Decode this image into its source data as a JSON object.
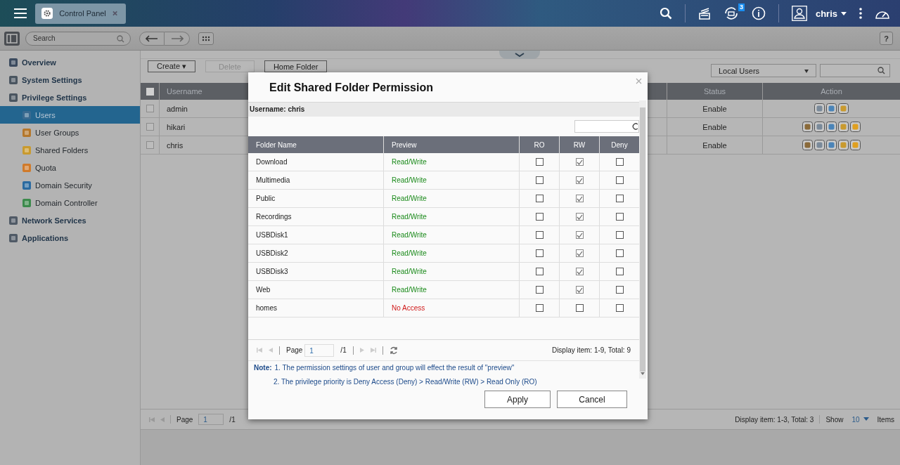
{
  "top_bar": {
    "app_tab": {
      "title": "Control Panel"
    },
    "notification_count": "3",
    "user": "chris"
  },
  "toolbar": {
    "search": {
      "placeholder": "Search"
    },
    "help": "?"
  },
  "sidebar": {
    "items": [
      {
        "label": "Overview",
        "selected": false
      },
      {
        "label": "System Settings",
        "selected": false
      },
      {
        "label": "Privilege Settings",
        "selected": false,
        "children": [
          {
            "label": "Users",
            "selected": true
          },
          {
            "label": "User Groups",
            "selected": false
          },
          {
            "label": "Shared Folders",
            "selected": false
          },
          {
            "label": "Quota",
            "selected": false
          },
          {
            "label": "Domain Security",
            "selected": false
          },
          {
            "label": "Domain Controller",
            "selected": false
          }
        ]
      },
      {
        "label": "Network Services",
        "selected": false
      },
      {
        "label": "Applications",
        "selected": false
      }
    ]
  },
  "users_panel": {
    "buttons": [
      {
        "label": "Create ▾",
        "disabled": false
      },
      {
        "label": "Delete",
        "disabled": true
      },
      {
        "label": "Home Folder",
        "disabled": false
      }
    ],
    "filter": "Local Users",
    "table": {
      "all_checked": false,
      "columns": [
        "Username",
        "Status",
        "Action"
      ],
      "rows": [
        {
          "username": "admin",
          "status": "Enable",
          "checked": false,
          "kind": "admin"
        },
        {
          "username": "hikari",
          "status": "Enable",
          "checked": false,
          "kind": "user"
        },
        {
          "username": "chris",
          "status": "Enable",
          "checked": false,
          "kind": "user"
        }
      ]
    },
    "pager": {
      "page_label": "Page",
      "page": "1",
      "of": "/1",
      "display": "Display item: 1-3, Total: 3",
      "show_label": "Show",
      "show_value": "10",
      "items_label": "Items"
    }
  },
  "dialog": {
    "title": "Edit Shared Folder Permission",
    "username": "Username: chris",
    "columns": [
      "Folder Name",
      "Preview",
      "RO",
      "RW",
      "Deny"
    ],
    "rows": [
      {
        "folder": "Download",
        "preview": "Read/Write",
        "kind": "rw",
        "ro": false,
        "rw": true,
        "deny": false
      },
      {
        "folder": "Multimedia",
        "preview": "Read/Write",
        "kind": "rw",
        "ro": false,
        "rw": true,
        "deny": false
      },
      {
        "folder": "Public",
        "preview": "Read/Write",
        "kind": "rw",
        "ro": false,
        "rw": true,
        "deny": false
      },
      {
        "folder": "Recordings",
        "preview": "Read/Write",
        "kind": "rw",
        "ro": false,
        "rw": true,
        "deny": false
      },
      {
        "folder": "USBDisk1",
        "preview": "Read/Write",
        "kind": "rw",
        "ro": false,
        "rw": true,
        "deny": false
      },
      {
        "folder": "USBDisk2",
        "preview": "Read/Write",
        "kind": "rw",
        "ro": false,
        "rw": true,
        "deny": false
      },
      {
        "folder": "USBDisk3",
        "preview": "Read/Write",
        "kind": "rw",
        "ro": false,
        "rw": true,
        "deny": false
      },
      {
        "folder": "Web",
        "preview": "Read/Write",
        "kind": "rw",
        "ro": false,
        "rw": true,
        "deny": false
      },
      {
        "folder": "homes",
        "preview": "No Access",
        "kind": "none",
        "ro": false,
        "rw": false,
        "deny": false
      }
    ],
    "pager": {
      "page_label": "Page",
      "page": "1",
      "of": "/1",
      "display": "Display item: 1-9, Total: 9"
    },
    "notes": [
      {
        "label": "Note:",
        "text": "1. The permission settings of user and group will effect the result of \"preview\""
      },
      {
        "text": "2. The privilege priority is Deny Access (Deny) > Read/Write (RW) > Read Only (RO)"
      }
    ],
    "buttons": [
      "Apply",
      "Cancel"
    ]
  }
}
